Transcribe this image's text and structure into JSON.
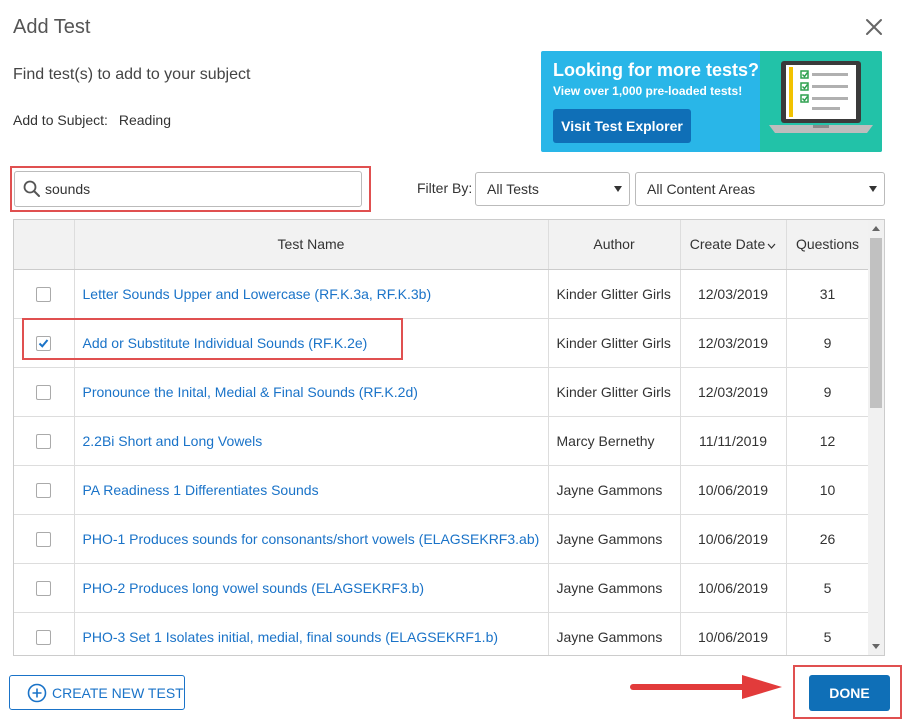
{
  "dialog": {
    "title": "Add Test",
    "subtitle": "Find test(s) to add to your subject",
    "subject_label": "Add to Subject:",
    "subject_value": "Reading"
  },
  "promo": {
    "headline": "Looking for more tests?",
    "subtext": "View over 1,000 pre-loaded tests!",
    "button_label": "Visit Test Explorer"
  },
  "search": {
    "value": "sounds",
    "icon": "search-icon"
  },
  "filters": {
    "label": "Filter By:",
    "tests_selected": "All Tests",
    "content_selected": "All Content Areas"
  },
  "table": {
    "headers": {
      "name": "Test Name",
      "author": "Author",
      "date": "Create Date",
      "questions": "Questions"
    },
    "sort_column": "Create Date",
    "rows": [
      {
        "checked": false,
        "name": "Letter Sounds Upper and Lowercase (RF.K.3a, RF.K.3b)",
        "author": "Kinder Glitter Girls",
        "date": "12/03/2019",
        "questions": "31"
      },
      {
        "checked": true,
        "name": "Add or Substitute Individual Sounds (RF.K.2e)",
        "author": "Kinder Glitter Girls",
        "date": "12/03/2019",
        "questions": "9"
      },
      {
        "checked": false,
        "name": "Pronounce the Inital, Medial & Final Sounds (RF.K.2d)",
        "author": "Kinder Glitter Girls",
        "date": "12/03/2019",
        "questions": "9"
      },
      {
        "checked": false,
        "name": "2.2Bi Short and Long Vowels",
        "author": "Marcy Bernethy",
        "date": "11/11/2019",
        "questions": "12"
      },
      {
        "checked": false,
        "name": "PA Readiness 1 Differentiates Sounds",
        "author": "Jayne Gammons",
        "date": "10/06/2019",
        "questions": "10"
      },
      {
        "checked": false,
        "name": "PHO-1 Produces sounds for consonants/short vowels (ELAGSEKRF3.ab)",
        "author": "Jayne Gammons",
        "date": "10/06/2019",
        "questions": "26"
      },
      {
        "checked": false,
        "name": "PHO-2 Produces long vowel sounds (ELAGSEKRF3.b)",
        "author": "Jayne Gammons",
        "date": "10/06/2019",
        "questions": "5"
      },
      {
        "checked": false,
        "name": "PHO-3 Set 1 Isolates initial, medial, final sounds (ELAGSEKRF1.b)",
        "author": "Jayne Gammons",
        "date": "10/06/2019",
        "questions": "5"
      }
    ]
  },
  "footer": {
    "create_label": "CREATE NEW TEST",
    "done_label": "DONE"
  },
  "colors": {
    "link": "#1a73c8",
    "primary_button": "#0f6fb7",
    "promo_bg": "#29b6e8",
    "promo_art_bg": "#22c2a8",
    "annotation": "#e05050"
  }
}
